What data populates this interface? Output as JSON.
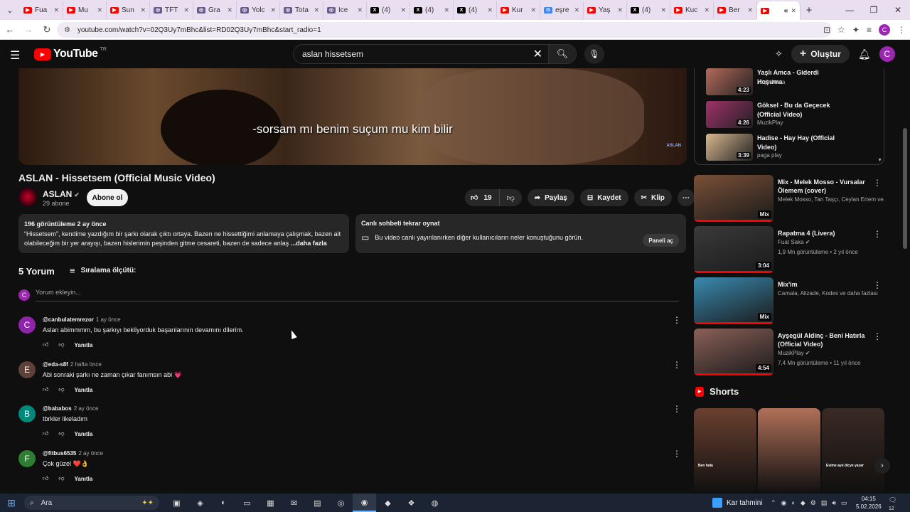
{
  "browser": {
    "tabs": [
      {
        "label": "Fua",
        "icon": "youtube-icon",
        "color": "#ff0000"
      },
      {
        "label": "Mu",
        "icon": "youtube-icon",
        "color": "#ff0000"
      },
      {
        "label": "Sun",
        "icon": "youtube-icon",
        "color": "#ff0000"
      },
      {
        "label": "TFT",
        "icon": "web-icon",
        "color": "#6b5b8c"
      },
      {
        "label": "Gra",
        "icon": "web-icon",
        "color": "#6b5b8c"
      },
      {
        "label": "Yolc",
        "icon": "web-icon",
        "color": "#6b5b8c"
      },
      {
        "label": "Tota",
        "icon": "web-icon",
        "color": "#6b5b8c"
      },
      {
        "label": "Ice",
        "icon": "web-icon",
        "color": "#6b5b8c"
      },
      {
        "label": "(4)",
        "icon": "x-icon",
        "color": "#000000"
      },
      {
        "label": "(4)",
        "icon": "x-icon",
        "color": "#000000"
      },
      {
        "label": "(4)",
        "icon": "x-icon",
        "color": "#000000"
      },
      {
        "label": "Kur",
        "icon": "youtube-icon",
        "color": "#ff0000"
      },
      {
        "label": "eşre",
        "icon": "google-icon",
        "color": "#4285f4"
      },
      {
        "label": "Yaş",
        "icon": "youtube-icon",
        "color": "#ff0000"
      },
      {
        "label": "(4)",
        "icon": "x-icon",
        "color": "#000000"
      },
      {
        "label": "Kuc",
        "icon": "youtube-icon",
        "color": "#ff0000"
      },
      {
        "label": "Ber",
        "icon": "youtube-icon",
        "color": "#ff0000"
      },
      {
        "label": "",
        "icon": "youtube-icon",
        "color": "#ff0000",
        "active": true
      }
    ],
    "url": "youtube.com/watch?v=02Q3Uy7mBhc&list=RD02Q3Uy7mBhc&start_radio=1",
    "profile_initial": "C"
  },
  "header": {
    "logo_text": "YouTube",
    "region": "TR",
    "search_value": "aslan hissetsem",
    "create_label": "Oluştur",
    "avatar_initial": "C"
  },
  "video": {
    "subtitle": "-sorsam mı benim suçum mu kim bilir",
    "watermark": "ASLAN",
    "title": "ASLAN - Hissetsem (Official Music Video)",
    "channel": "ASLAN",
    "subscribers": "29 abone",
    "subscribe_label": "Abone ol",
    "likes": "19",
    "share_label": "Paylaş",
    "save_label": "Kaydet",
    "clip_label": "Klip"
  },
  "description": {
    "meta": "196 görüntüleme  2 ay önce",
    "text": "“Hissetsem”, kendime yazdığım bir şarkı olarak çıktı ortaya.  Bazen ne hissettiğimi anlamaya çalışmak, bazen ait olabileceğim bir yer arayışı, bazen hislerimin peşinden gitme cesareti, bazen de sadece anlaş",
    "more": "...daha fazla"
  },
  "chat_replay": {
    "title": "Canlı sohbeti tekrar oynat",
    "text": "Bu video canlı yayınlanırken diğer kullanıcıların neler konuştuğunu görün.",
    "button": "Paneli aç"
  },
  "comments_section": {
    "count": "5 Yorum",
    "sort_label": "Sıralama ölçütü:",
    "add_placeholder": "Yorum ekleyin...",
    "add_avatar": "C",
    "reply_label": "Yanıtla",
    "items": [
      {
        "initial": "C",
        "color": "#8e24aa",
        "user": "@canbulatemrezor",
        "time": "1 ay önce",
        "text": "Aslan abimmmm, bu şarkıyı bekliyorduk başarılarının devamını dilerim."
      },
      {
        "initial": "E",
        "color": "#5d4037",
        "user": "@eda-s8f",
        "time": "2 hafta önce",
        "text": "Abi sonraki şarkı ne zaman çıkar fanımsın abi 💗"
      },
      {
        "initial": "B",
        "color": "#00897b",
        "user": "@bababos",
        "time": "2 ay önce",
        "text": "tbrkler likeladım"
      },
      {
        "initial": "F",
        "color": "#2e7d32",
        "user": "@fitbus6535",
        "time": "2 ay önce",
        "text": "Çok güzel ❤️👌"
      }
    ]
  },
  "playlist": {
    "items": [
      {
        "title": "Yaşlı Amca - Giderdi Hoşuma",
        "channel": "Yaşlı Amca",
        "duration": "4:23",
        "color": "#b46a5a"
      },
      {
        "title": "Göksel - Bu da Geçecek (Official Video)",
        "channel": "MuzikPlay",
        "duration": "4:26",
        "color": "#a0306a"
      },
      {
        "title": "Hadise - Hay Hay (Official Video)",
        "channel": "paga play",
        "duration": "3:39",
        "color": "#d8b890"
      }
    ]
  },
  "recommendations": [
    {
      "title": "Mix - Melek Mosso - Vursalar Ölemem (cover)",
      "channel": "Melek Mosso, Tan Taşçı, Ceylan Ertem ve...",
      "meta": "",
      "badge": "Mix",
      "color": "#7a5038",
      "verified": false
    },
    {
      "title": "Rapatma 4 (Livera)",
      "channel": "Fuat Saka",
      "meta": "1,9 Mn görüntüleme • 2 yıl önce",
      "badge": "3:04",
      "color": "#3a3a3a",
      "verified": true
    },
    {
      "title": "Mix'im",
      "channel": "Camala, Alizade, Kodes ve daha fazlası",
      "meta": "",
      "badge": "Mix",
      "color": "#3a8ab0",
      "verified": false
    },
    {
      "title": "Ayşegül Aldinç - Beni Hatırla (Official Video)",
      "channel": "MuzikPlay",
      "meta": "7,4 Mn görüntüleme • 11 yıl önce",
      "badge": "4:54",
      "color": "#8a6058",
      "verified": true
    }
  ],
  "shorts": {
    "title": "Shorts",
    "items": [
      {
        "caption": "Ben hala",
        "color": "#6a4030"
      },
      {
        "caption": "",
        "color": "#b07058"
      },
      {
        "caption": "Evime ayıi dicye yazar",
        "color": "#3a2a24"
      }
    ]
  },
  "taskbar": {
    "search_placeholder": "Ara",
    "weather": "Kar tahmini",
    "time": "04:15",
    "date": "5.02.2026",
    "notif_count": "12"
  }
}
